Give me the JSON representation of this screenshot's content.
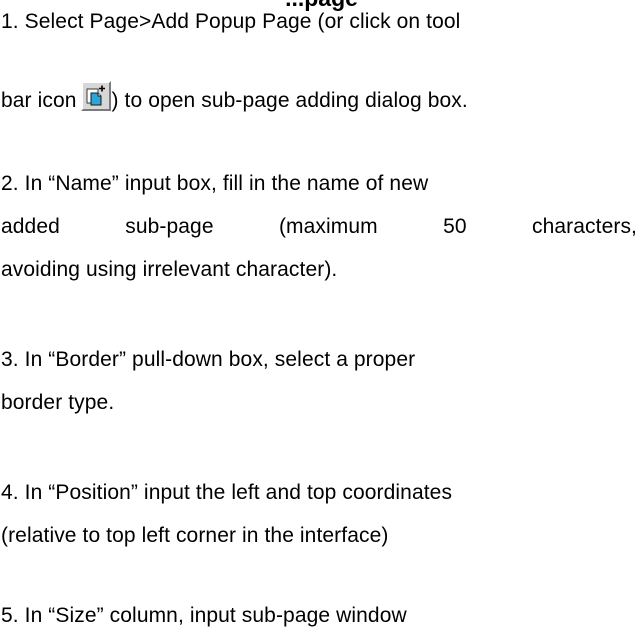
{
  "doc": {
    "heading": "...page",
    "step1": {
      "line1": "1. Select Page>Add Popup Page (or click on tool",
      "line2_before": "bar icon",
      "icon": "add-popup-page-icon",
      "line2_after": ") to open sub-page adding dialog box."
    },
    "step2": {
      "line1": "2. In “Name” input box, fill in the name of new",
      "line2": "added sub-page (maximum 50 characters,",
      "line3": "avoiding using irrelevant character)."
    },
    "step3": {
      "line1": "3. In “Border” pull-down box, select a proper",
      "line2": "border type."
    },
    "step4": {
      "line1": "4. In “Position” input the left and top coordinates",
      "line2": "(relative to top left corner in the interface)"
    },
    "step5": {
      "line1": "5. In “Size” column, input sub-page window"
    }
  }
}
